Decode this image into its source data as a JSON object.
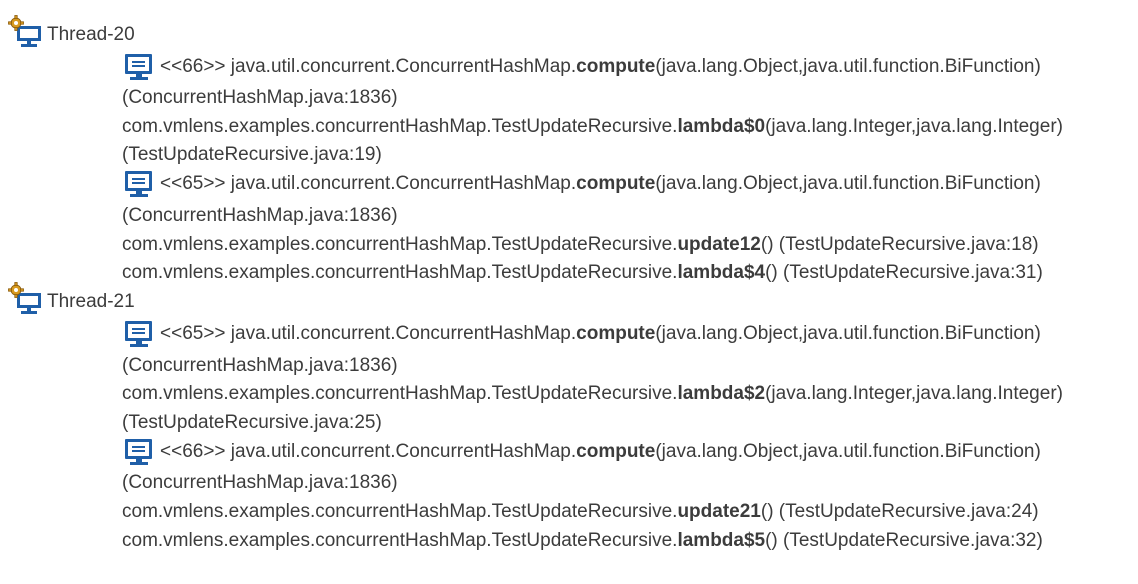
{
  "icons": {
    "thread": "thread-gear-monitor-icon",
    "frame": "monitor-icon"
  },
  "colors": {
    "text": "#3c3c3c",
    "icon_blue": "#1f5fa8",
    "gear": "#d89a1e"
  },
  "threads": [
    {
      "name": "Thread-20",
      "frames": [
        {
          "monitor": "<<66>>",
          "line1": {
            "pre": " java.util.concurrent.ConcurrentHashMap.",
            "method": "compute",
            "post": "(java.lang.Object,java.util.function.BiFunction)"
          },
          "line2": "(ConcurrentHashMap.java:1836)",
          "calls": [
            {
              "pre": "com.vmlens.examples.concurrentHashMap.TestUpdateRecursive.",
              "method": "lambda$0",
              "post": "(java.lang.Integer,java.lang.Integer)"
            },
            {
              "text": "(TestUpdateRecursive.java:19)"
            }
          ]
        },
        {
          "monitor": "<<65>>",
          "line1": {
            "pre": " java.util.concurrent.ConcurrentHashMap.",
            "method": "compute",
            "post": "(java.lang.Object,java.util.function.BiFunction)"
          },
          "line2": "(ConcurrentHashMap.java:1836)",
          "calls": [
            {
              "pre": "com.vmlens.examples.concurrentHashMap.TestUpdateRecursive.",
              "method": "update12",
              "post": "() (TestUpdateRecursive.java:18)"
            },
            {
              "pre": "com.vmlens.examples.concurrentHashMap.TestUpdateRecursive.",
              "method": "lambda$4",
              "post": "() (TestUpdateRecursive.java:31)"
            }
          ]
        }
      ]
    },
    {
      "name": "Thread-21",
      "frames": [
        {
          "monitor": "<<65>>",
          "line1": {
            "pre": " java.util.concurrent.ConcurrentHashMap.",
            "method": "compute",
            "post": "(java.lang.Object,java.util.function.BiFunction)"
          },
          "line2": "(ConcurrentHashMap.java:1836)",
          "calls": [
            {
              "pre": "com.vmlens.examples.concurrentHashMap.TestUpdateRecursive.",
              "method": "lambda$2",
              "post": "(java.lang.Integer,java.lang.Integer)"
            },
            {
              "text": "(TestUpdateRecursive.java:25)"
            }
          ]
        },
        {
          "monitor": "<<66>>",
          "line1": {
            "pre": " java.util.concurrent.ConcurrentHashMap.",
            "method": "compute",
            "post": "(java.lang.Object,java.util.function.BiFunction)"
          },
          "line2": "(ConcurrentHashMap.java:1836)",
          "calls": [
            {
              "pre": "com.vmlens.examples.concurrentHashMap.TestUpdateRecursive.",
              "method": "update21",
              "post": "() (TestUpdateRecursive.java:24)"
            },
            {
              "pre": "com.vmlens.examples.concurrentHashMap.TestUpdateRecursive.",
              "method": "lambda$5",
              "post": "() (TestUpdateRecursive.java:32)"
            }
          ]
        }
      ]
    }
  ]
}
